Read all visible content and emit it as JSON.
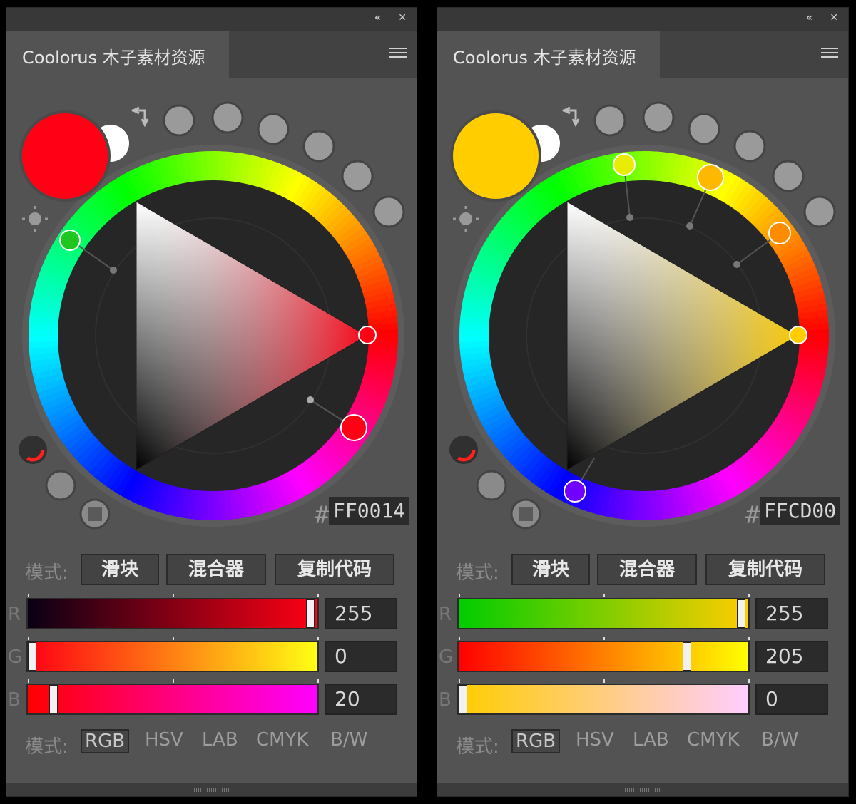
{
  "panels": [
    {
      "title": "Coolorus 木子素材资源",
      "hex_prefix": "#",
      "hex": "FF0014",
      "primary_color": "#FF0014",
      "secondary_color": "#FFFFFF",
      "mode_label": "模式:",
      "mode_buttons": [
        "滑块",
        "混合器",
        "复制代码"
      ],
      "channels": [
        {
          "label": "R",
          "value": "255",
          "fraction": 1.0,
          "gradient": [
            "#0A0014",
            "#FF0014"
          ]
        },
        {
          "label": "G",
          "value": "0",
          "fraction": 0.0,
          "gradient": [
            "#FF0014",
            "#FFFF14"
          ]
        },
        {
          "label": "B",
          "value": "20",
          "fraction": 0.078,
          "gradient": [
            "#FF0000",
            "#FF00FF"
          ]
        }
      ],
      "color_modes_label": "模式:",
      "color_modes": [
        "RGB",
        "HSV",
        "LAB",
        "CMYK",
        "B/W"
      ],
      "active_color_mode": "RGB"
    },
    {
      "title": "Coolorus 木子素材资源",
      "hex_prefix": "#",
      "hex": "FFCD00",
      "primary_color": "#FFCD00",
      "secondary_color": "#FFFFFF",
      "mode_label": "模式:",
      "mode_buttons": [
        "滑块",
        "混合器",
        "复制代码"
      ],
      "channels": [
        {
          "label": "R",
          "value": "255",
          "fraction": 1.0,
          "gradient": [
            "#00CD00",
            "#FFCD00"
          ]
        },
        {
          "label": "G",
          "value": "205",
          "fraction": 0.804,
          "gradient": [
            "#FF0000",
            "#FFFF00"
          ]
        },
        {
          "label": "B",
          "value": "0",
          "fraction": 0.0,
          "gradient": [
            "#FFCD00",
            "#FFCDFF"
          ]
        }
      ],
      "color_modes_label": "模式:",
      "color_modes": [
        "RGB",
        "HSV",
        "LAB",
        "CMYK",
        "B/W"
      ],
      "active_color_mode": "RGB"
    }
  ],
  "icons": {
    "collapse": "double-chevron-left-icon",
    "close": "close-icon",
    "menu": "hamburger-menu-icon",
    "swap": "swap-colors-icon",
    "light": "brightness-icon",
    "harmony_presets": "harmony-preset-icon"
  }
}
